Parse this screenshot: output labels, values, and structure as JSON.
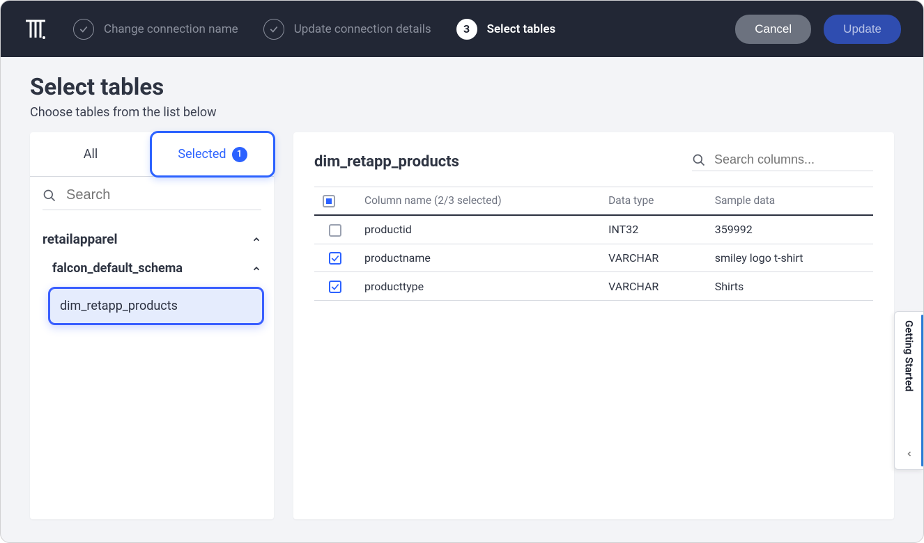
{
  "steps": [
    {
      "label": "Change connection name",
      "state": "done"
    },
    {
      "label": "Update connection details",
      "state": "done"
    },
    {
      "label": "Select tables",
      "state": "active",
      "num": "3"
    }
  ],
  "buttons": {
    "cancel": "Cancel",
    "update": "Update"
  },
  "page": {
    "title": "Select tables",
    "subtitle": "Choose tables from the list below"
  },
  "tabs": {
    "all": "All",
    "selected": "Selected",
    "count": "1"
  },
  "search": {
    "placeholder": "Search"
  },
  "tree": {
    "db": "retailapparel",
    "schema": "falcon_default_schema",
    "table": "dim_retapp_products"
  },
  "right": {
    "title": "dim_retapp_products",
    "searchPlaceholder": "Search columns...",
    "headers": {
      "col": "Column name (2/3 selected)",
      "type": "Data type",
      "sample": "Sample data"
    },
    "rows": [
      {
        "checked": false,
        "name": "productid",
        "type": "INT32",
        "sample": "359992"
      },
      {
        "checked": true,
        "name": "productname",
        "type": "VARCHAR",
        "sample": "smiley logo t-shirt"
      },
      {
        "checked": true,
        "name": "producttype",
        "type": "VARCHAR",
        "sample": "Shirts"
      }
    ]
  },
  "sidetab": {
    "label": "Getting Started"
  }
}
